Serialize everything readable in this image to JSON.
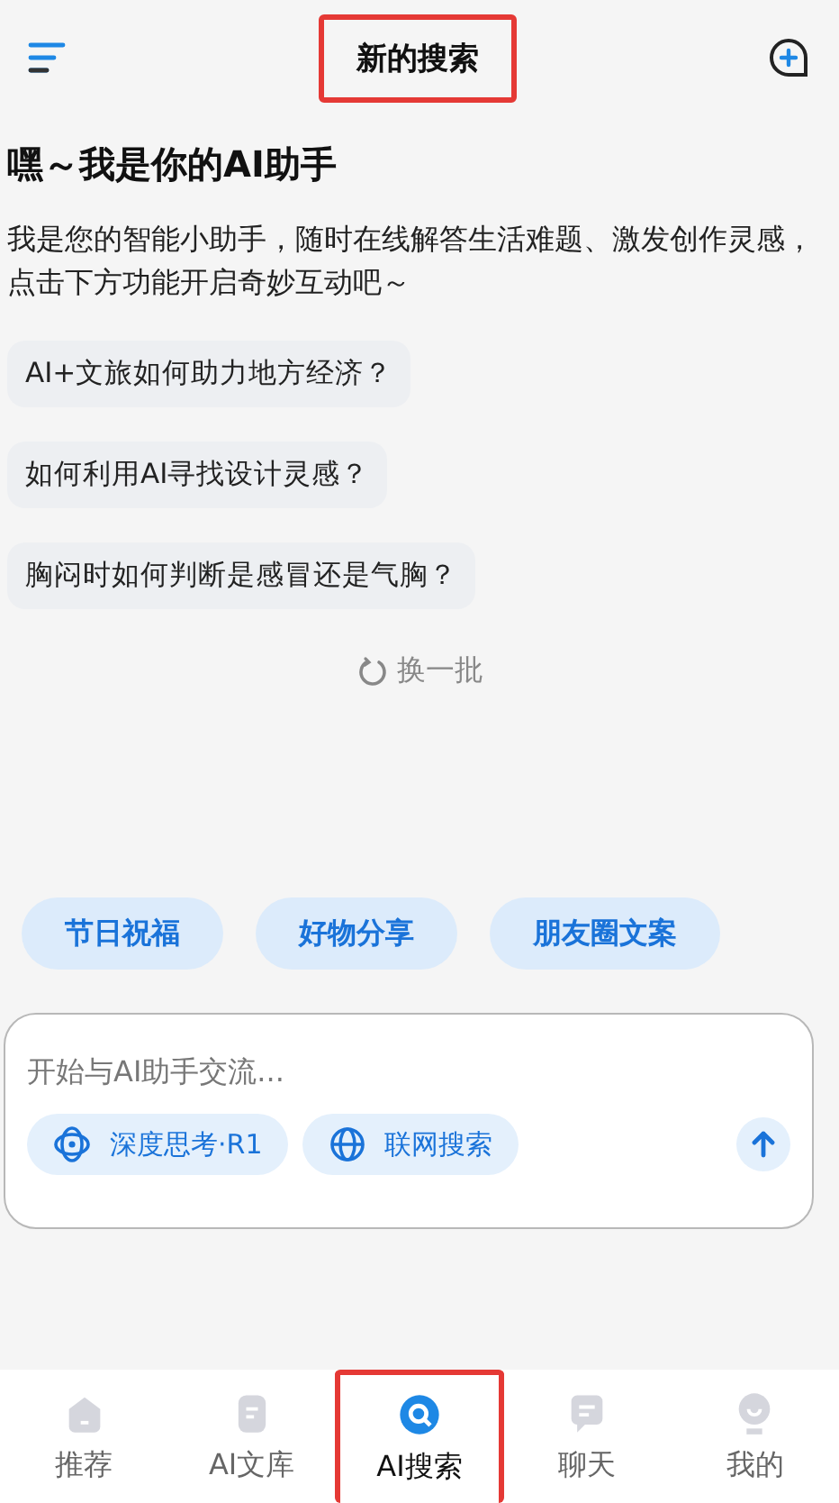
{
  "header": {
    "title": "新的搜索",
    "title_highlighted": true
  },
  "greeting": "嘿～我是你的AI助手",
  "intro": "我是您的智能小助手，随时在线解答生活难题、激发创作灵感，点击下方功能开启奇妙互动吧～",
  "suggestions": [
    "AI+文旅如何助力地方经济？",
    "如何利用AI寻找设计灵感？",
    "胸闷时如何判断是感冒还是气胸？"
  ],
  "refresh": "换一批",
  "quick_actions": [
    "节日祝福",
    "好物分享",
    "朋友圈文案"
  ],
  "composer": {
    "placeholder": "开始与AI助手交流...",
    "options": [
      {
        "label": "深度思考·R1",
        "kind": "think"
      },
      {
        "label": "联网搜索",
        "kind": "web"
      }
    ]
  },
  "tabs": [
    {
      "label": "推荐",
      "kind": "home",
      "selected": false,
      "highlighted": false
    },
    {
      "label": "AI文库",
      "kind": "doc",
      "selected": false,
      "highlighted": false
    },
    {
      "label": "AI搜索",
      "kind": "search",
      "selected": true,
      "highlighted": true
    },
    {
      "label": "聊天",
      "kind": "chat",
      "selected": false,
      "highlighted": false
    },
    {
      "label": "我的",
      "kind": "me",
      "selected": false,
      "highlighted": false
    }
  ]
}
